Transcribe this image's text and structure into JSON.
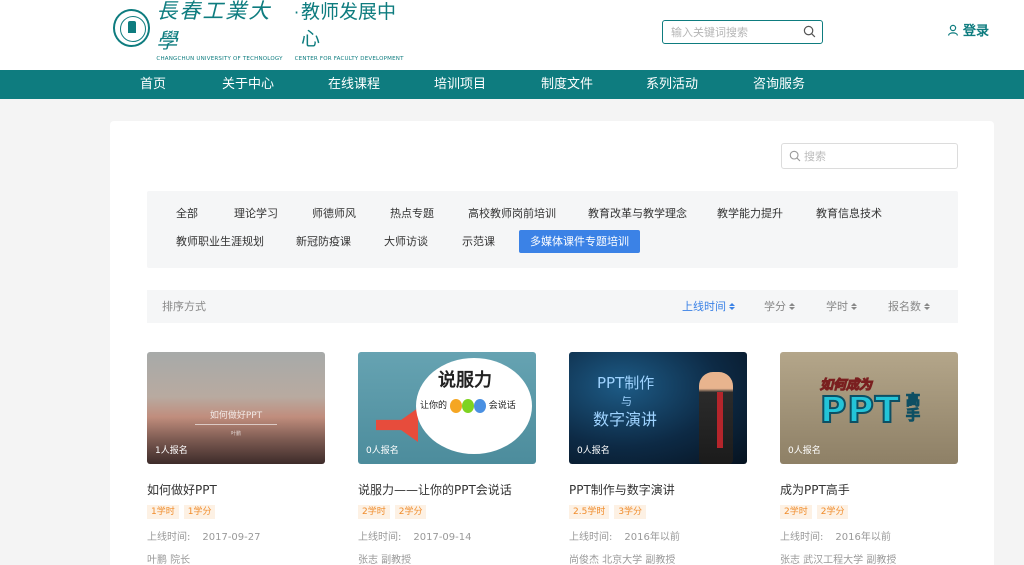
{
  "header": {
    "logo_cn": "長春工業大學",
    "logo_center": "教师发展中心",
    "logo_en_left": "CHANGCHUN UNIVERSITY OF TECHNOLOGY",
    "logo_en_right": "CENTER FOR FACULTY DEVELOPMENT",
    "search_placeholder": "输入关键词搜索",
    "login_label": "登录"
  },
  "nav": [
    "首页",
    "关于中心",
    "在线课程",
    "培训项目",
    "制度文件",
    "系列活动",
    "咨询服务"
  ],
  "main": {
    "search_placeholder": "搜索",
    "categories": [
      "全部",
      "理论学习",
      "师德师风",
      "热点专题",
      "高校教师岗前培训",
      "教育改革与教学理念",
      "教学能力提升",
      "教育信息技术",
      "教师职业生涯规划",
      "新冠防疫课",
      "大师访谈",
      "示范课",
      "多媒体课件专题培训"
    ],
    "active_category": "多媒体课件专题培训",
    "sort_label": "排序方式",
    "sort_options": [
      "上线时间",
      "学分",
      "学时",
      "报名数"
    ],
    "active_sort": "上线时间"
  },
  "courses": [
    {
      "title": "如何做好PPT",
      "enrolled": "1人报名",
      "hours": "1学时",
      "credits": "1学分",
      "date_label": "上线时间:",
      "date": "2017-09-27",
      "teacher": "叶鹏 院长",
      "thumb_caption": "如何做好PPT",
      "thumb_sub": "叶鹏"
    },
    {
      "title": "说服力——让你的PPT会说话",
      "enrolled": "0人报名",
      "hours": "2学时",
      "credits": "2学分",
      "date_label": "上线时间:",
      "date": "2017-09-14",
      "teacher": "张志 副教授",
      "thumb_big": "说服力",
      "thumb_small_a": "让你的",
      "thumb_small_b": "会说话"
    },
    {
      "title": "PPT制作与数字演讲",
      "enrolled": "0人报名",
      "hours": "2.5学时",
      "credits": "3学分",
      "date_label": "上线时间:",
      "date": "2016年以前",
      "teacher": "尚俊杰 北京大学 副教授",
      "thumb_l1": "PPT制作",
      "thumb_l2": "与",
      "thumb_l3": "数字演讲"
    },
    {
      "title": "成为PPT高手",
      "enrolled": "0人报名",
      "hours": "2学时",
      "credits": "2学分",
      "date_label": "上线时间:",
      "date": "2016年以前",
      "teacher": "张志 武汉工程大学 副教授",
      "thumb_top": "如何成为",
      "thumb_ppt": "PPT",
      "thumb_gao": "高手"
    }
  ],
  "colors": {
    "brand": "#0e7c7f",
    "accent": "#3b82e6",
    "badge_bg": "#fdf1e4",
    "badge_text": "#f08c2b"
  }
}
